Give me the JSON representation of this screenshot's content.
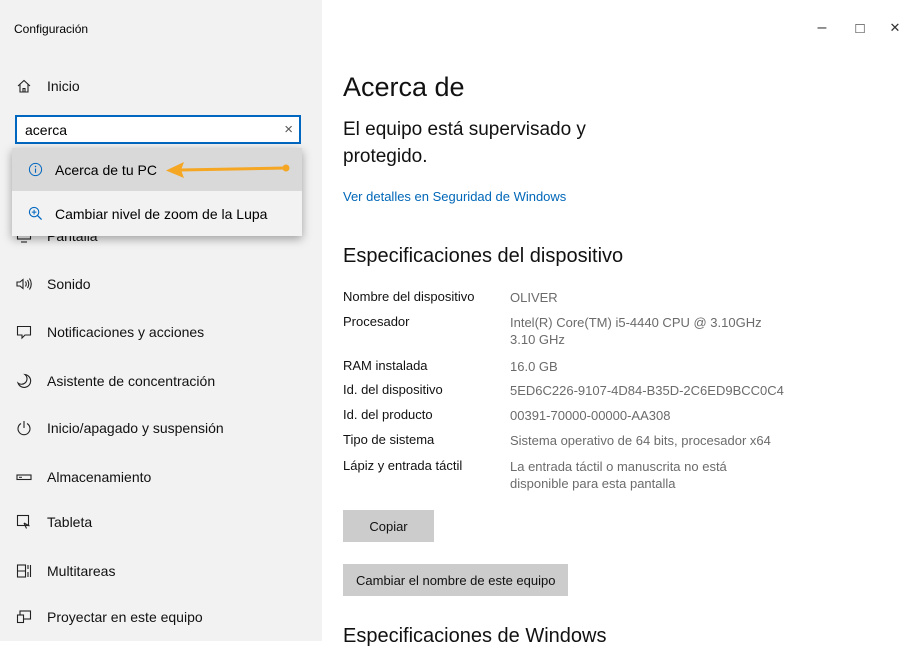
{
  "window": {
    "title": "Configuración",
    "controls": {
      "minimize": "–",
      "maximize": "□",
      "close": "✕"
    }
  },
  "sidebar": {
    "home_label": "Inicio",
    "search": {
      "value": "acerca",
      "clear": "×"
    },
    "suggestions": [
      {
        "label": "Acerca de tu PC",
        "icon": "info-icon"
      },
      {
        "label": "Cambiar nivel de zoom de la Lupa",
        "icon": "magnifier-icon"
      }
    ],
    "partial_item_label": "Pantalla",
    "items": [
      {
        "label": "Sonido",
        "icon": "sound-icon"
      },
      {
        "label": "Notificaciones y acciones",
        "icon": "notifications-icon"
      },
      {
        "label": "Asistente de concentración",
        "icon": "moon-icon"
      },
      {
        "label": "Inicio/apagado y suspensión",
        "icon": "power-icon"
      },
      {
        "label": "Almacenamiento",
        "icon": "storage-icon"
      },
      {
        "label": "Tableta",
        "icon": "tablet-icon"
      },
      {
        "label": "Multitareas",
        "icon": "multitasking-icon"
      },
      {
        "label": "Proyectar en este equipo",
        "icon": "projector-icon"
      }
    ]
  },
  "main": {
    "title": "Acerca de",
    "protection_text": "El equipo está supervisado y protegido.",
    "security_link": "Ver detalles en Seguridad de Windows",
    "device_specs_heading": "Especificaciones del dispositivo",
    "specs": [
      {
        "label": "Nombre del dispositivo",
        "value": "OLIVER"
      },
      {
        "label": "Procesador",
        "value": "Intel(R) Core(TM) i5-4440 CPU @ 3.10GHz 3.10 GHz"
      },
      {
        "label": "RAM instalada",
        "value": "16.0 GB"
      },
      {
        "label": "Id. del dispositivo",
        "value": "5ED6C226-9107-4D84-B35D-2C6ED9BCC0C4"
      },
      {
        "label": "Id. del producto",
        "value": "00391-70000-00000-AA308"
      },
      {
        "label": "Tipo de sistema",
        "value": "Sistema operativo de 64 bits, procesador x64"
      },
      {
        "label": "Lápiz y entrada táctil",
        "value": "La entrada táctil o manuscrita no está disponible para esta pantalla"
      }
    ],
    "copy_button": "Copiar",
    "rename_button": "Cambiar el nombre de este equipo",
    "windows_specs_heading": "Especificaciones de Windows"
  },
  "colors": {
    "accent": "#0067c0",
    "annotation_arrow": "#f5a623",
    "sidebar_bg": "#f2f2f2"
  }
}
